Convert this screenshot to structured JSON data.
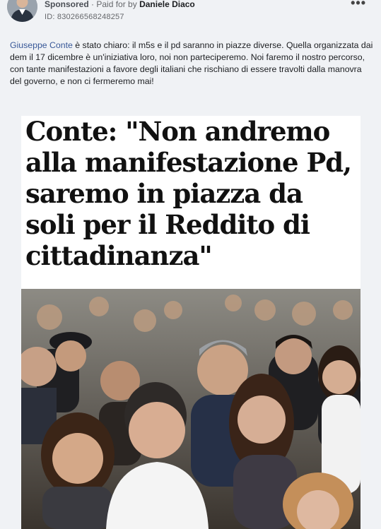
{
  "ad": {
    "sponsored_label": "Sponsored",
    "paid_prefix": "· Paid for by",
    "advertiser": "Daniele Diaco",
    "ad_id": "ID: 830266568248257",
    "more_icon": "more-horizontal-icon",
    "more_symbol": "•••"
  },
  "post": {
    "mention": "Giuseppe Conte",
    "body": " è stato chiaro: il m5s e il pd saranno in piazze diverse. Quella organizzata dai dem il 17 dicembre è un'iniziativa loro, noi non parteciperemo. Noi faremo il nostro percorso, con tante manifestazioni a favore degli italiani che rischiano di essere travolti dalla manovra del governo, e non ci fermeremo mai!"
  },
  "image": {
    "headline": "Conte: \"Non andremo alla manifestazione Pd, saremo in piazza da soli per il Reddito di cittadinanza\""
  },
  "colors": {
    "link": "#385898",
    "background": "#f0f2f5"
  }
}
